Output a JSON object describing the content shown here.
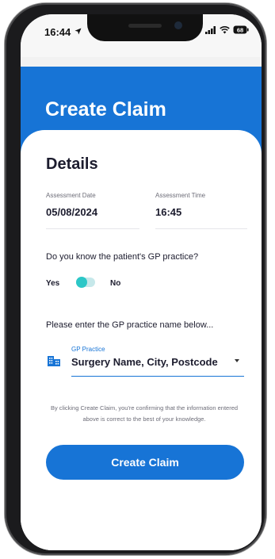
{
  "statusbar": {
    "time": "16:44",
    "battery": "68"
  },
  "header": {
    "title": "Create Claim"
  },
  "details": {
    "section_title": "Details",
    "assessment_date_label": "Assessment Date",
    "assessment_date_value": "05/08/2024",
    "assessment_time_label": "Assessment Time",
    "assessment_time_value": "16:45"
  },
  "gp_question": {
    "text": "Do you know the patient's GP practice?",
    "yes_label": "Yes",
    "no_label": "No"
  },
  "gp_practice": {
    "prompt": "Please enter the GP practice name below...",
    "label": "GP Practice",
    "value": "Surgery Name, City, Postcode"
  },
  "disclaimer": "By clicking Create Claim, you're confirming that the information entered above is correct to the best of your knowledge.",
  "cta": {
    "label": "Create Claim"
  },
  "colors": {
    "primary": "#1774d6",
    "toggle": "#2cc7c7"
  }
}
